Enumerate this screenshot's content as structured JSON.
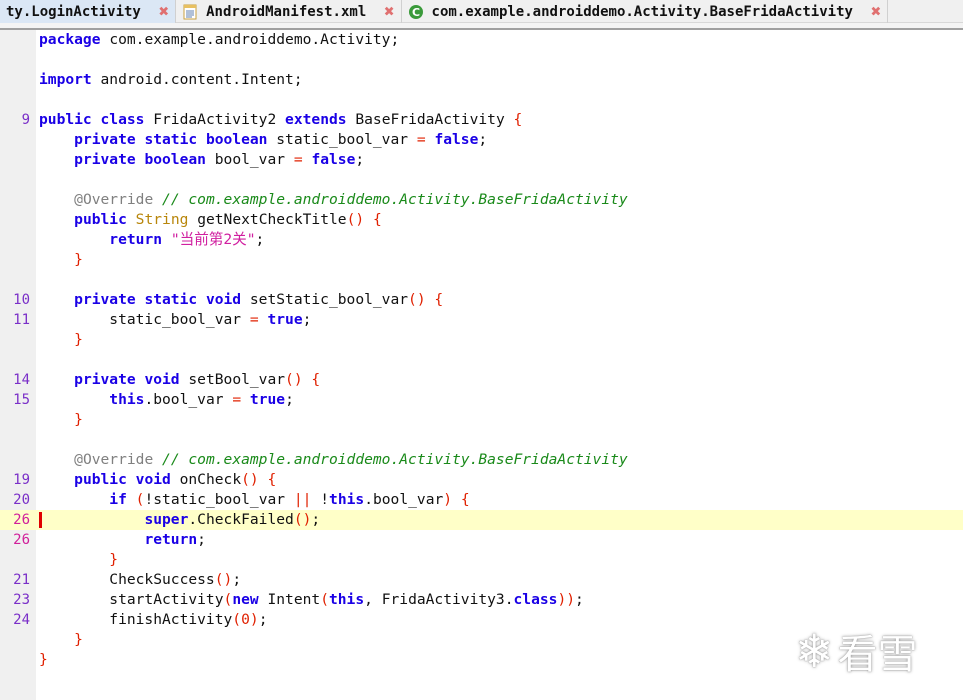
{
  "tabs": [
    {
      "label": "ty.LoginActivity",
      "icon": "java-class-icon",
      "active": true
    },
    {
      "label": "AndroidManifest.xml",
      "icon": "xml-file-icon",
      "active": false
    },
    {
      "label": "com.example.androiddemo.Activity.BaseFridaActivity",
      "icon": "class-c-icon",
      "active": false
    }
  ],
  "editor": {
    "highlighted_line_index": 24,
    "lines": [
      {
        "ln": "",
        "tokens": [
          [
            "k",
            "package"
          ],
          [
            "",
            "com.example.androiddemo.Activity;"
          ]
        ]
      },
      {
        "ln": "",
        "tokens": []
      },
      {
        "ln": "",
        "tokens": [
          [
            "k",
            "import"
          ],
          [
            "",
            "android.content.Intent;"
          ]
        ]
      },
      {
        "ln": "",
        "tokens": []
      },
      {
        "ln": "9",
        "tokens": [
          [
            "k",
            "public class"
          ],
          [
            "",
            "FridaActivity2"
          ],
          [
            "k",
            "extends"
          ],
          [
            "",
            "BaseFridaActivity"
          ],
          [
            "p",
            "{"
          ]
        ]
      },
      {
        "ln": "",
        "tokens": [
          [
            "",
            "    "
          ],
          [
            "k",
            "private static boolean"
          ],
          [
            "",
            "static_bool_var"
          ],
          [
            "p",
            "="
          ],
          [
            "k",
            "false"
          ],
          [
            "",
            ";"
          ]
        ]
      },
      {
        "ln": "",
        "tokens": [
          [
            "",
            "    "
          ],
          [
            "k",
            "private boolean"
          ],
          [
            "",
            "bool_var"
          ],
          [
            "p",
            "="
          ],
          [
            "k",
            "false"
          ],
          [
            "",
            ";"
          ]
        ]
      },
      {
        "ln": "",
        "tokens": []
      },
      {
        "ln": "",
        "tokens": [
          [
            "",
            "    "
          ],
          [
            "a",
            "@Override"
          ],
          [
            "c",
            "// com.example.androiddemo.Activity.BaseFridaActivity"
          ]
        ]
      },
      {
        "ln": "",
        "tokens": [
          [
            "",
            "    "
          ],
          [
            "k",
            "public"
          ],
          [
            "t",
            "String"
          ],
          [
            "",
            "getNextCheckTitle"
          ],
          [
            "p",
            "()"
          ],
          [
            "p",
            "{"
          ]
        ]
      },
      {
        "ln": "",
        "tokens": [
          [
            "",
            "        "
          ],
          [
            "k",
            "return"
          ],
          [
            "s",
            "\"当前第2关\""
          ],
          [
            "",
            ";"
          ]
        ]
      },
      {
        "ln": "",
        "tokens": [
          [
            "",
            "    "
          ],
          [
            "p",
            "}"
          ]
        ]
      },
      {
        "ln": "",
        "tokens": []
      },
      {
        "ln": "10",
        "tokens": [
          [
            "",
            "    "
          ],
          [
            "k",
            "private static void"
          ],
          [
            "",
            "setStatic_bool_var"
          ],
          [
            "p",
            "()"
          ],
          [
            "p",
            "{"
          ]
        ]
      },
      {
        "ln": "11",
        "tokens": [
          [
            "",
            "        static_bool_var"
          ],
          [
            "p",
            "="
          ],
          [
            "k",
            "true"
          ],
          [
            "",
            ";"
          ]
        ]
      },
      {
        "ln": "",
        "tokens": [
          [
            "",
            "    "
          ],
          [
            "p",
            "}"
          ]
        ]
      },
      {
        "ln": "",
        "tokens": []
      },
      {
        "ln": "14",
        "tokens": [
          [
            "",
            "    "
          ],
          [
            "k",
            "private void"
          ],
          [
            "",
            "setBool_var"
          ],
          [
            "p",
            "()"
          ],
          [
            "p",
            "{"
          ]
        ]
      },
      {
        "ln": "15",
        "tokens": [
          [
            "",
            "        "
          ],
          [
            "k",
            "this"
          ],
          [
            "",
            ".bool_var"
          ],
          [
            "p",
            "="
          ],
          [
            "k",
            "true"
          ],
          [
            "",
            ";"
          ]
        ]
      },
      {
        "ln": "",
        "tokens": [
          [
            "",
            "    "
          ],
          [
            "p",
            "}"
          ]
        ]
      },
      {
        "ln": "",
        "tokens": []
      },
      {
        "ln": "",
        "tokens": [
          [
            "",
            "    "
          ],
          [
            "a",
            "@Override"
          ],
          [
            "c",
            "// com.example.androiddemo.Activity.BaseFridaActivity"
          ]
        ]
      },
      {
        "ln": "19",
        "tokens": [
          [
            "",
            "    "
          ],
          [
            "k",
            "public void"
          ],
          [
            "",
            "onCheck"
          ],
          [
            "p",
            "()"
          ],
          [
            "p",
            "{"
          ]
        ]
      },
      {
        "ln": "20",
        "tokens": [
          [
            "",
            "        "
          ],
          [
            "k",
            "if"
          ],
          [
            "p",
            "("
          ],
          [
            "",
            "!static_bool_var"
          ],
          [
            "p",
            "||"
          ],
          [
            "",
            "!"
          ],
          [
            "k",
            "this"
          ],
          [
            "",
            ".bool_var"
          ],
          [
            "p",
            ")"
          ],
          [
            "p",
            "{"
          ]
        ]
      },
      {
        "ln": "26",
        "tokens": [
          [
            "",
            "            "
          ],
          [
            "k",
            "super"
          ],
          [
            "",
            ".CheckFailed"
          ],
          [
            "p",
            "()"
          ],
          [
            "",
            ";"
          ]
        ]
      },
      {
        "ln": "26",
        "tokens": [
          [
            "",
            "            "
          ],
          [
            "k",
            "return"
          ],
          [
            "",
            ";"
          ]
        ]
      },
      {
        "ln": "",
        "tokens": [
          [
            "",
            "        "
          ],
          [
            "p",
            "}"
          ]
        ]
      },
      {
        "ln": "21",
        "tokens": [
          [
            "",
            "        CheckSuccess"
          ],
          [
            "p",
            "()"
          ],
          [
            "",
            ";"
          ]
        ]
      },
      {
        "ln": "23",
        "tokens": [
          [
            "",
            "        startActivity"
          ],
          [
            "p",
            "("
          ],
          [
            "k",
            "new"
          ],
          [
            "",
            "Intent"
          ],
          [
            "p",
            "("
          ],
          [
            "k",
            "this"
          ],
          [
            "",
            ", FridaActivity3."
          ],
          [
            "k",
            "class"
          ],
          [
            "p",
            "))"
          ],
          [
            "",
            ";"
          ]
        ]
      },
      {
        "ln": "24",
        "tokens": [
          [
            "",
            "        finishActivity"
          ],
          [
            "p",
            "("
          ],
          [
            "n",
            "0"
          ],
          [
            "p",
            ")"
          ],
          [
            "",
            ";"
          ]
        ]
      },
      {
        "ln": "",
        "tokens": [
          [
            "",
            "    "
          ],
          [
            "p",
            "}"
          ]
        ]
      },
      {
        "ln": "",
        "tokens": [
          [
            "p",
            "}"
          ]
        ]
      }
    ]
  },
  "watermark": {
    "text": "看雪",
    "icon": "snowflake-icon"
  }
}
